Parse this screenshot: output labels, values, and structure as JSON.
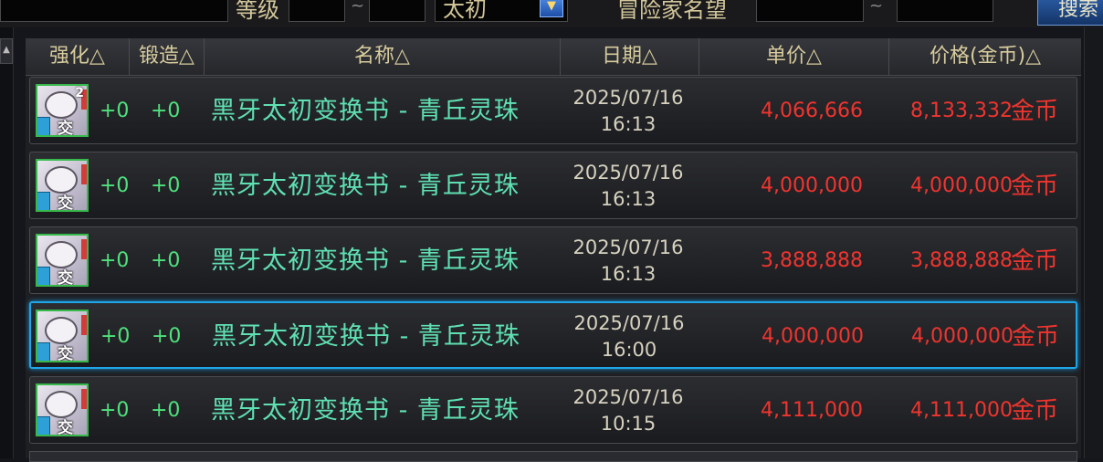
{
  "search": {
    "level_label": "等级",
    "tilde": "~",
    "grade_value": "太初",
    "reputation_label": "冒险家名望",
    "search_button": "搜索"
  },
  "columns": [
    "强化△",
    "锻造△",
    "名称△",
    "日期△",
    "单价△",
    "价格(金币)△"
  ],
  "rows": [
    {
      "qty": "2",
      "trade": "交易",
      "enhance": "+0",
      "forge": "+0",
      "name": "黑牙太初变换书 - 青丘灵珠",
      "date": "2025/07/16",
      "time": "16:13",
      "unit_price": "4,066,666",
      "price": "8,133,332",
      "currency": "金币",
      "selected": false
    },
    {
      "qty": "",
      "trade": "交易",
      "enhance": "+0",
      "forge": "+0",
      "name": "黑牙太初变换书 - 青丘灵珠",
      "date": "2025/07/16",
      "time": "16:13",
      "unit_price": "4,000,000",
      "price": "4,000,000",
      "currency": "金币",
      "selected": false
    },
    {
      "qty": "",
      "trade": "交易",
      "enhance": "+0",
      "forge": "+0",
      "name": "黑牙太初变换书 - 青丘灵珠",
      "date": "2025/07/16",
      "time": "16:13",
      "unit_price": "3,888,888",
      "price": "3,888,888",
      "currency": "金币",
      "selected": false
    },
    {
      "qty": "",
      "trade": "交易",
      "enhance": "+0",
      "forge": "+0",
      "name": "黑牙太初变换书 - 青丘灵珠",
      "date": "2025/07/16",
      "time": "16:00",
      "unit_price": "4,000,000",
      "price": "4,000,000",
      "currency": "金币",
      "selected": true
    },
    {
      "qty": "",
      "trade": "交易",
      "enhance": "+0",
      "forge": "+0",
      "name": "黑牙太初变换书 - 青丘灵珠",
      "date": "2025/07/16",
      "time": "10:15",
      "unit_price": "4,111,000",
      "price": "4,111,000",
      "currency": "金币",
      "selected": false
    }
  ]
}
